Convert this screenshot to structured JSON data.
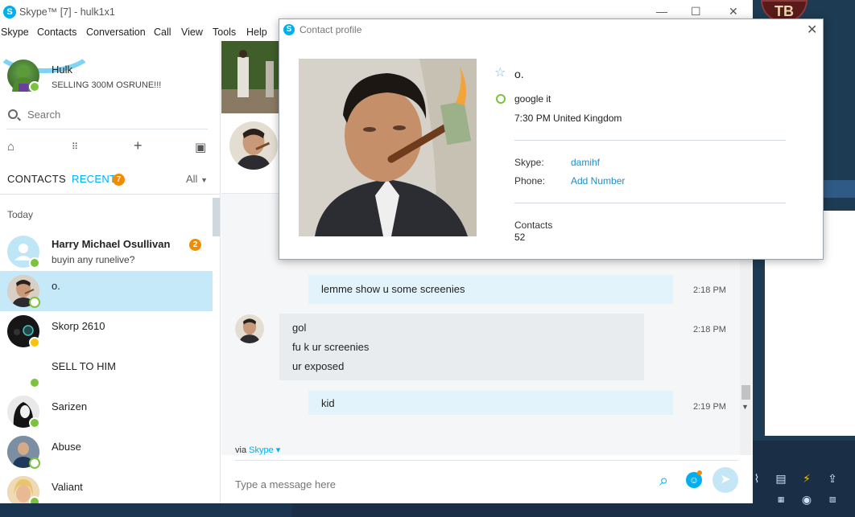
{
  "window": {
    "title": "Skype™ [7] - hulk1x1",
    "minimize": "—",
    "maximize": "☐",
    "close": "✕"
  },
  "menu": [
    "Skype",
    "Contacts",
    "Conversation",
    "Call",
    "View",
    "Tools",
    "Help"
  ],
  "profile": {
    "name": "Hulk",
    "mood": "SELLING 300M OSRUNE!!!"
  },
  "search": {
    "placeholder": "Search"
  },
  "toolbar_icons": [
    "home-icon",
    "dialpad-icon",
    "plus-icon",
    "bot-icon"
  ],
  "tabs": {
    "contacts": "CONTACTS",
    "recent": "RECENT",
    "recent_badge": "7",
    "filter": "All"
  },
  "section": "Today",
  "contacts": [
    {
      "name": "Harry Michael Osullivan",
      "sub": "buyin any runelive?",
      "badge": "2",
      "status": "online",
      "bold": true
    },
    {
      "name": "o.",
      "sub": "",
      "badge": "",
      "status": "offline",
      "bold": false,
      "selected": true
    },
    {
      "name": "Skorp 2610",
      "sub": "",
      "badge": "",
      "status": "away",
      "bold": false
    },
    {
      "name": "SELL TO HIM",
      "sub": "",
      "badge": "",
      "status": "online",
      "bold": false
    },
    {
      "name": "Sarizen",
      "sub": "",
      "badge": "",
      "status": "online",
      "bold": false
    },
    {
      "name": "Abuse",
      "sub": "",
      "badge": "",
      "status": "offline",
      "bold": false
    },
    {
      "name": "Valiant",
      "sub": "",
      "badge": "",
      "status": "online",
      "bold": false
    }
  ],
  "messages": [
    {
      "dir": "out",
      "lines": [
        "lemme show u some screenies"
      ],
      "time": "2:18 PM"
    },
    {
      "dir": "in",
      "lines": [
        "gol",
        "fu k ur screenies",
        "ur exposed"
      ],
      "time": "2:18 PM"
    },
    {
      "dir": "out",
      "lines": [
        "kid"
      ],
      "time": "2:19 PM"
    }
  ],
  "via": {
    "prefix": "via",
    "link": "Skype ▾"
  },
  "compose": {
    "placeholder": "Type a message here"
  },
  "popup": {
    "title": "Contact profile",
    "name": "o.",
    "mood": "google it",
    "local_time": "7:30 PM United Kingdom",
    "skype_label": "Skype:",
    "skype_value": "damihf",
    "phone_label": "Phone:",
    "phone_value": "Add Number",
    "contacts_label": "Contacts",
    "contacts_count": "52"
  },
  "bg_logo": "TB",
  "colors": {
    "accent": "#00aff0",
    "online": "#7cc23c",
    "away": "#f9c20b",
    "badge": "#f38b00",
    "selected_row": "#c6e9f9"
  }
}
